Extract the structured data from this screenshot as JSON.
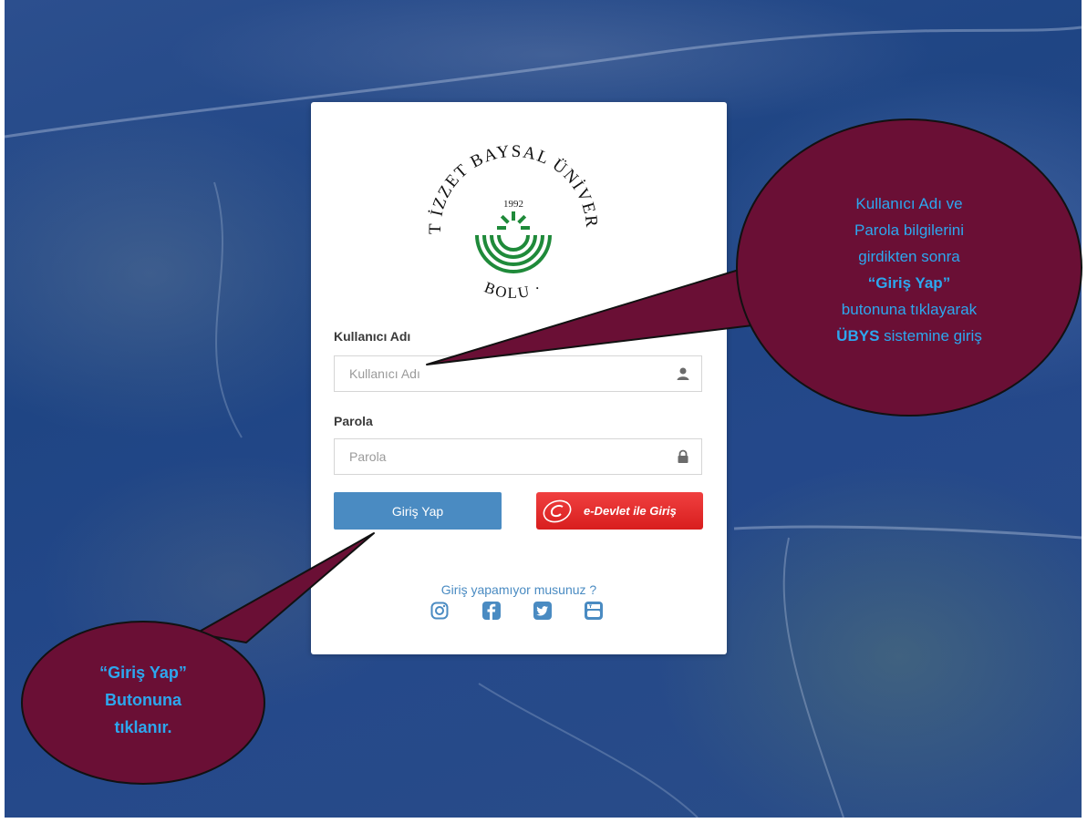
{
  "logo": {
    "arc_text": "ABANT İZZET BAYSAL ÜNİVERSİTESİ · BOLU",
    "year": "1992",
    "alt": "Abant İzzet Baysal Üniversitesi logosu"
  },
  "form": {
    "username_label": "Kullanıcı Adı",
    "username_placeholder": "Kullanıcı Adı",
    "password_label": "Parola",
    "password_placeholder": "Parola",
    "login_button": "Giriş Yap",
    "edevlet_button": "e-Devlet ile Giriş",
    "help_link": "Giriş yapamıyor musunuz ?"
  },
  "social": [
    "instagram-icon",
    "facebook-icon",
    "twitter-icon",
    "youtube-icon"
  ],
  "callouts": {
    "right": {
      "line1": "Kullanıcı Adı ve",
      "line2": "Parola bilgilerini",
      "line3": "girdikten sonra",
      "line4_bold": "“Giriş Yap”",
      "line5": "butonuna tıklayarak",
      "line6_bold": "ÜBYS",
      "line6_rest": " sistemine giriş"
    },
    "left": {
      "line1": "“Giriş Yap”",
      "line2": "Butonuna",
      "line3": "tıklanır."
    }
  },
  "colors": {
    "primary_button": "#4a8bc2",
    "edevlet_red": "#e02a2a",
    "callout_fill": "#6a0f35",
    "callout_text": "#2da7ee",
    "logo_green": "#1f8a3a"
  }
}
